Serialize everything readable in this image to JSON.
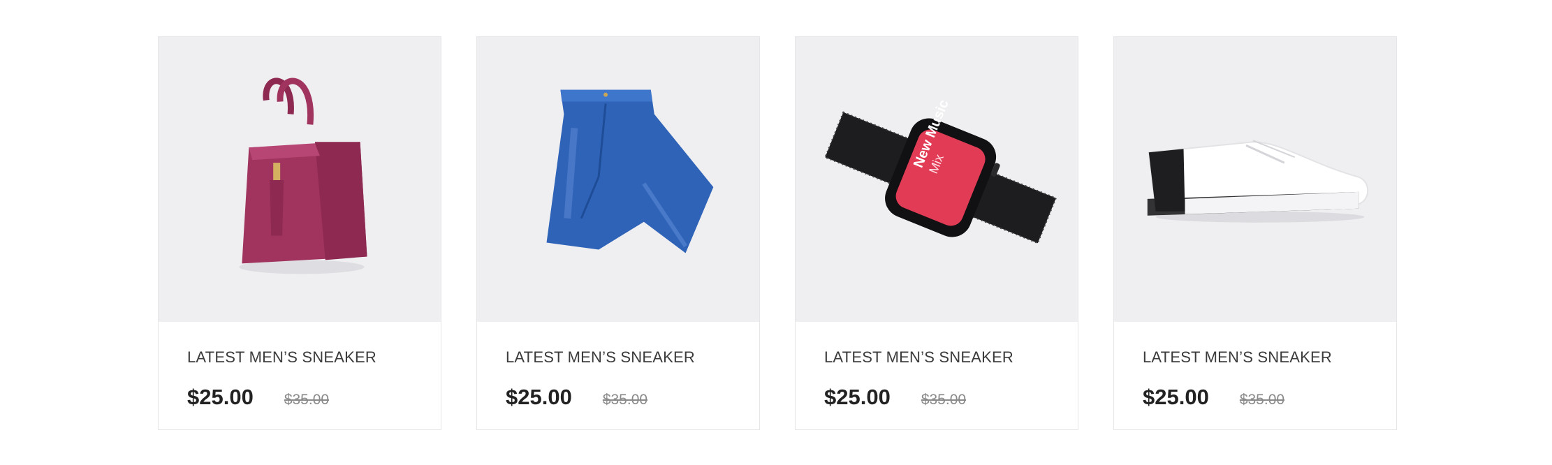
{
  "products": [
    {
      "image_icon": "handbag-image",
      "title": "LATEST MEN’S SNEAKER",
      "price": "$25.00",
      "old_price": "$35.00"
    },
    {
      "image_icon": "jeans-image",
      "title": "LATEST MEN’S SNEAKER",
      "price": "$25.00",
      "old_price": "$35.00"
    },
    {
      "image_icon": "smartwatch-image",
      "title": "LATEST MEN’S SNEAKER",
      "price": "$25.00",
      "old_price": "$35.00",
      "watch_screen_text": [
        "New Music",
        "Mix"
      ]
    },
    {
      "image_icon": "sneaker-image",
      "title": "LATEST MEN’S SNEAKER",
      "price": "$25.00",
      "old_price": "$35.00"
    }
  ],
  "colors": {
    "media_background": "#efeff1",
    "handbag": "#a0345f",
    "jeans": "#2f63b8",
    "watch_screen": "#e23b55"
  }
}
